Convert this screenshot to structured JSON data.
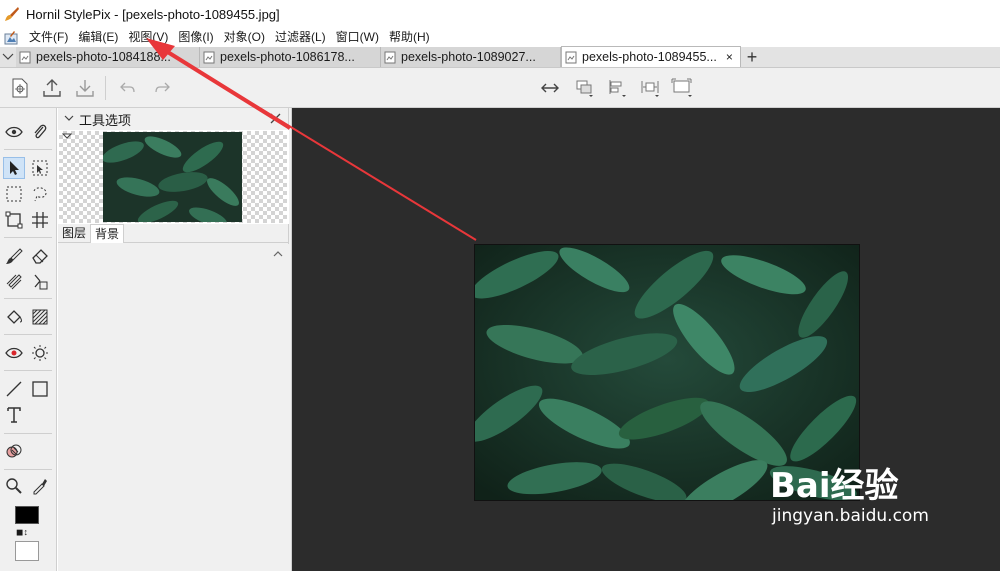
{
  "window": {
    "title": "Hornil StylePix - [pexels-photo-1089455.jpg]",
    "app_icon": "brush-icon"
  },
  "menubar": {
    "items": [
      "文件(F)",
      "编辑(E)",
      "视图(V)",
      "图像(I)",
      "对象(O)",
      "过滤器(L)",
      "窗口(W)",
      "帮助(H)"
    ]
  },
  "tabs": {
    "items": [
      {
        "label": "pexels-photo-1084188...",
        "active": false
      },
      {
        "label": "pexels-photo-1086178...",
        "active": false
      },
      {
        "label": "pexels-photo-1089027...",
        "active": false
      },
      {
        "label": "pexels-photo-1089455...",
        "active": true
      }
    ],
    "close_glyph": "×",
    "new_tab_glyph": "+"
  },
  "toolbar": {
    "left_icons": [
      "new-document-icon",
      "export-icon",
      "import-icon",
      "undo-icon",
      "redo-icon"
    ],
    "center_icons": [
      "flip-horizontal-icon",
      "arrange-icon",
      "align-icon",
      "distribute-icon",
      "canvas-size-icon"
    ]
  },
  "tools": {
    "icons": [
      "eye-icon",
      "paperclip-icon",
      "move-icon",
      "transform-icon",
      "rect-select-icon",
      "lasso-icon",
      "crop-icon",
      "grid-crop-icon",
      "brush-icon",
      "eraser-icon",
      "clone-icon",
      "patch-icon",
      "fill-icon",
      "gradient-icon",
      "red-eye-icon",
      "brightness-icon",
      "line-icon",
      "rectangle-icon",
      "text-icon",
      "color-balance-icon",
      "zoom-icon",
      "eyedropper-icon"
    ],
    "selected": "move-icon",
    "foreground_color": "#000000",
    "background_color": "#ffffff"
  },
  "panel": {
    "title": "工具选项",
    "tabs": [
      {
        "label": "图层",
        "active": false
      },
      {
        "label": "背景",
        "active": true
      }
    ]
  },
  "watermark": {
    "logo_text": "Bai经验",
    "url": "jingyan.baidu.com"
  },
  "colors": {
    "canvas_bg": "#2c2c2c",
    "annotation_arrow": "#e8373a",
    "selected_tool": "#cfe3f7"
  }
}
